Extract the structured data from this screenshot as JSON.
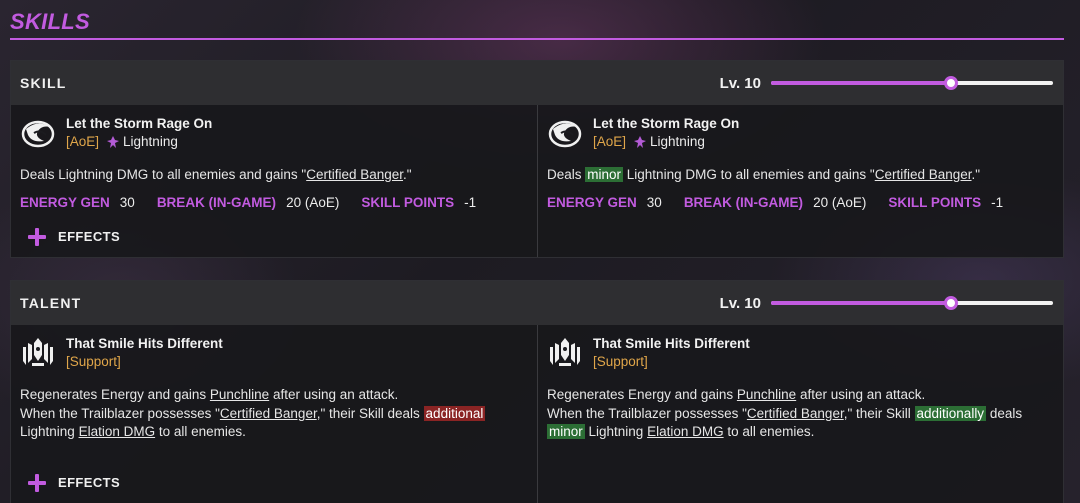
{
  "page": {
    "title": "SKILLS"
  },
  "colors": {
    "accent": "#c25be0",
    "tag": "#e0a64a",
    "buff_highlight": "#2c6e35",
    "nerf_highlight": "#8a2424"
  },
  "skill": {
    "section_label": "SKILL",
    "level_label": "Lv. 10",
    "level_fraction": 0.637,
    "left": {
      "icon": "storm-skill-icon",
      "name": "Let the Storm Rage On",
      "tag": "[AoE]",
      "element": "Lightning",
      "element_icon": "lightning-element-icon",
      "desc_1": "Deals Lightning DMG to all enemies and gains \"",
      "desc_link": "Certified Banger",
      "desc_2": ".\"",
      "stats": [
        {
          "key": "ENERGY GEN",
          "value": "30"
        },
        {
          "key": "BREAK (IN-GAME)",
          "value": "20 (AoE)"
        },
        {
          "key": "SKILL POINTS",
          "value": "-1"
        }
      ],
      "effects_label": "EFFECTS"
    },
    "right": {
      "icon": "storm-skill-icon",
      "name": "Let the Storm Rage On",
      "tag": "[AoE]",
      "element": "Lightning",
      "element_icon": "lightning-element-icon",
      "desc_1": "Deals ",
      "desc_hl": "minor",
      "desc_2": " Lightning DMG to all enemies and gains \"",
      "desc_link": "Certified Banger",
      "desc_3": ".\"",
      "stats": [
        {
          "key": "ENERGY GEN",
          "value": "30"
        },
        {
          "key": "BREAK (IN-GAME)",
          "value": "20 (AoE)"
        },
        {
          "key": "SKILL POINTS",
          "value": "-1"
        }
      ]
    }
  },
  "talent": {
    "section_label": "TALENT",
    "level_label": "Lv. 10",
    "level_fraction": 0.637,
    "left": {
      "icon": "mech-talent-icon",
      "name": "That Smile Hits Different",
      "tag": "[Support]",
      "line1_a": "Regenerates Energy and gains ",
      "line1_link": "Punchline",
      "line1_b": " after using an attack.",
      "line2_a": "When the Trailblazer possesses \"",
      "line2_link": "Certified Banger",
      "line2_b": ",\" their Skill deals ",
      "line2_hl": "additional",
      "line3_a": "Lightning ",
      "line3_link": "Elation DMG",
      "line3_b": " to all enemies.",
      "effects_label": "EFFECTS"
    },
    "right": {
      "icon": "mech-talent-icon",
      "name": "That Smile Hits Different",
      "tag": "[Support]",
      "line1_a": "Regenerates Energy and gains ",
      "line1_link": "Punchline",
      "line1_b": " after using an attack.",
      "line2_a": "When the Trailblazer possesses \"",
      "line2_link": "Certified Banger",
      "line2_b": ",\" their Skill ",
      "line2_hl": "additionally",
      "line2_c": " deals",
      "line3_hl": "minor",
      "line3_a": " Lightning ",
      "line3_link": "Elation DMG",
      "line3_b": " to all enemies."
    }
  }
}
